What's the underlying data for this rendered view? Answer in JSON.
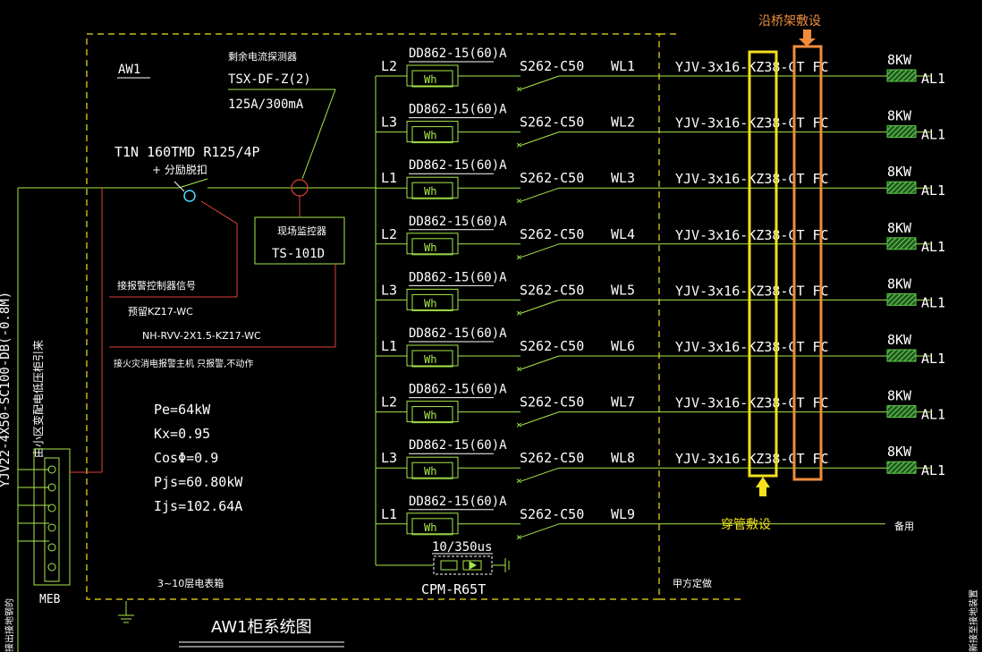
{
  "panel": {
    "name": "AW1",
    "drawing_title": "AW1柜系统图",
    "floors_note": "3~10层电表箱",
    "owner_note": "甲方定做",
    "incoming_cable": "YJV22-4X50-SC100-DB(-0.8M)",
    "incoming_source": "由小区变配电低压柜引来",
    "meb_label": "MEB",
    "left_edge_note": "接出接地钢的",
    "right_edge_note": "新接至接地装置"
  },
  "main_breaker": {
    "model": "T1N 160TMD R125/4P",
    "accessory": "+ 分励脱扣"
  },
  "rcm": {
    "title": "剩余电流探测器",
    "model": "TSX-DF-Z(2)",
    "rating": "125A/300mA"
  },
  "monitor": {
    "title": "现场监控器",
    "model": "TS-101D"
  },
  "fire_signal": {
    "label": "接报警控制器信号",
    "reserve": "预留KZ17-WC",
    "cable": "NH-RVV-2X1.5-KZ17-WC",
    "note": "接火灾消电报警主机 只报警,不动作"
  },
  "load_calc": [
    "Pe=64kW",
    "Kx=0.95",
    "CosΦ=0.9",
    "Pjs=60.80kW",
    "Ijs=102.64A"
  ],
  "circuits": [
    {
      "phase": "L2",
      "meter": "DD862-15(60)A",
      "meter_symbol": "Wh",
      "breaker": "S262-C50",
      "wl": "WL1",
      "cable": "YJV-3x16-KZ38-CT FC",
      "load": "8KW",
      "dest": "AL1"
    },
    {
      "phase": "L3",
      "meter": "DD862-15(60)A",
      "meter_symbol": "Wh",
      "breaker": "S262-C50",
      "wl": "WL2",
      "cable": "YJV-3x16-KZ38-CT FC",
      "load": "8KW",
      "dest": "AL1"
    },
    {
      "phase": "L1",
      "meter": "DD862-15(60)A",
      "meter_symbol": "Wh",
      "breaker": "S262-C50",
      "wl": "WL3",
      "cable": "YJV-3x16-KZ38-CT FC",
      "load": "8KW",
      "dest": "AL1"
    },
    {
      "phase": "L2",
      "meter": "DD862-15(60)A",
      "meter_symbol": "Wh",
      "breaker": "S262-C50",
      "wl": "WL4",
      "cable": "YJV-3x16-KZ38-CT FC",
      "load": "8KW",
      "dest": "AL1"
    },
    {
      "phase": "L3",
      "meter": "DD862-15(60)A",
      "meter_symbol": "Wh",
      "breaker": "S262-C50",
      "wl": "WL5",
      "cable": "YJV-3x16-KZ38-CT FC",
      "load": "8KW",
      "dest": "AL1"
    },
    {
      "phase": "L1",
      "meter": "DD862-15(60)A",
      "meter_symbol": "Wh",
      "breaker": "S262-C50",
      "wl": "WL6",
      "cable": "YJV-3x16-KZ38-CT FC",
      "load": "8KW",
      "dest": "AL1"
    },
    {
      "phase": "L2",
      "meter": "DD862-15(60)A",
      "meter_symbol": "Wh",
      "breaker": "S262-C50",
      "wl": "WL7",
      "cable": "YJV-3x16-KZ38-CT FC",
      "load": "8KW",
      "dest": "AL1"
    },
    {
      "phase": "L3",
      "meter": "DD862-15(60)A",
      "meter_symbol": "Wh",
      "breaker": "S262-C50",
      "wl": "WL8",
      "cable": "YJV-3x16-KZ38-CT FC",
      "load": "8KW",
      "dest": "AL1"
    },
    {
      "phase": "L1",
      "meter": "DD862-15(60)A",
      "meter_symbol": "Wh",
      "breaker": "S262-C50",
      "wl": "WL9",
      "cable": "",
      "load": "",
      "dest": "备用"
    }
  ],
  "spd": {
    "rating": "10/350us",
    "model": "CPM-R65T"
  },
  "annotations": {
    "tray_note": "沿桥架敷设",
    "conduit_note": "穿管敷设"
  },
  "colors": {
    "background": "#000000",
    "text": "#ffffff",
    "line": "#a8e84a",
    "control_line": "#e0433a",
    "highlight_yellow": "#f4e01c",
    "highlight_orange": "#f08c3c",
    "load_hatch": "#5cc84a"
  }
}
